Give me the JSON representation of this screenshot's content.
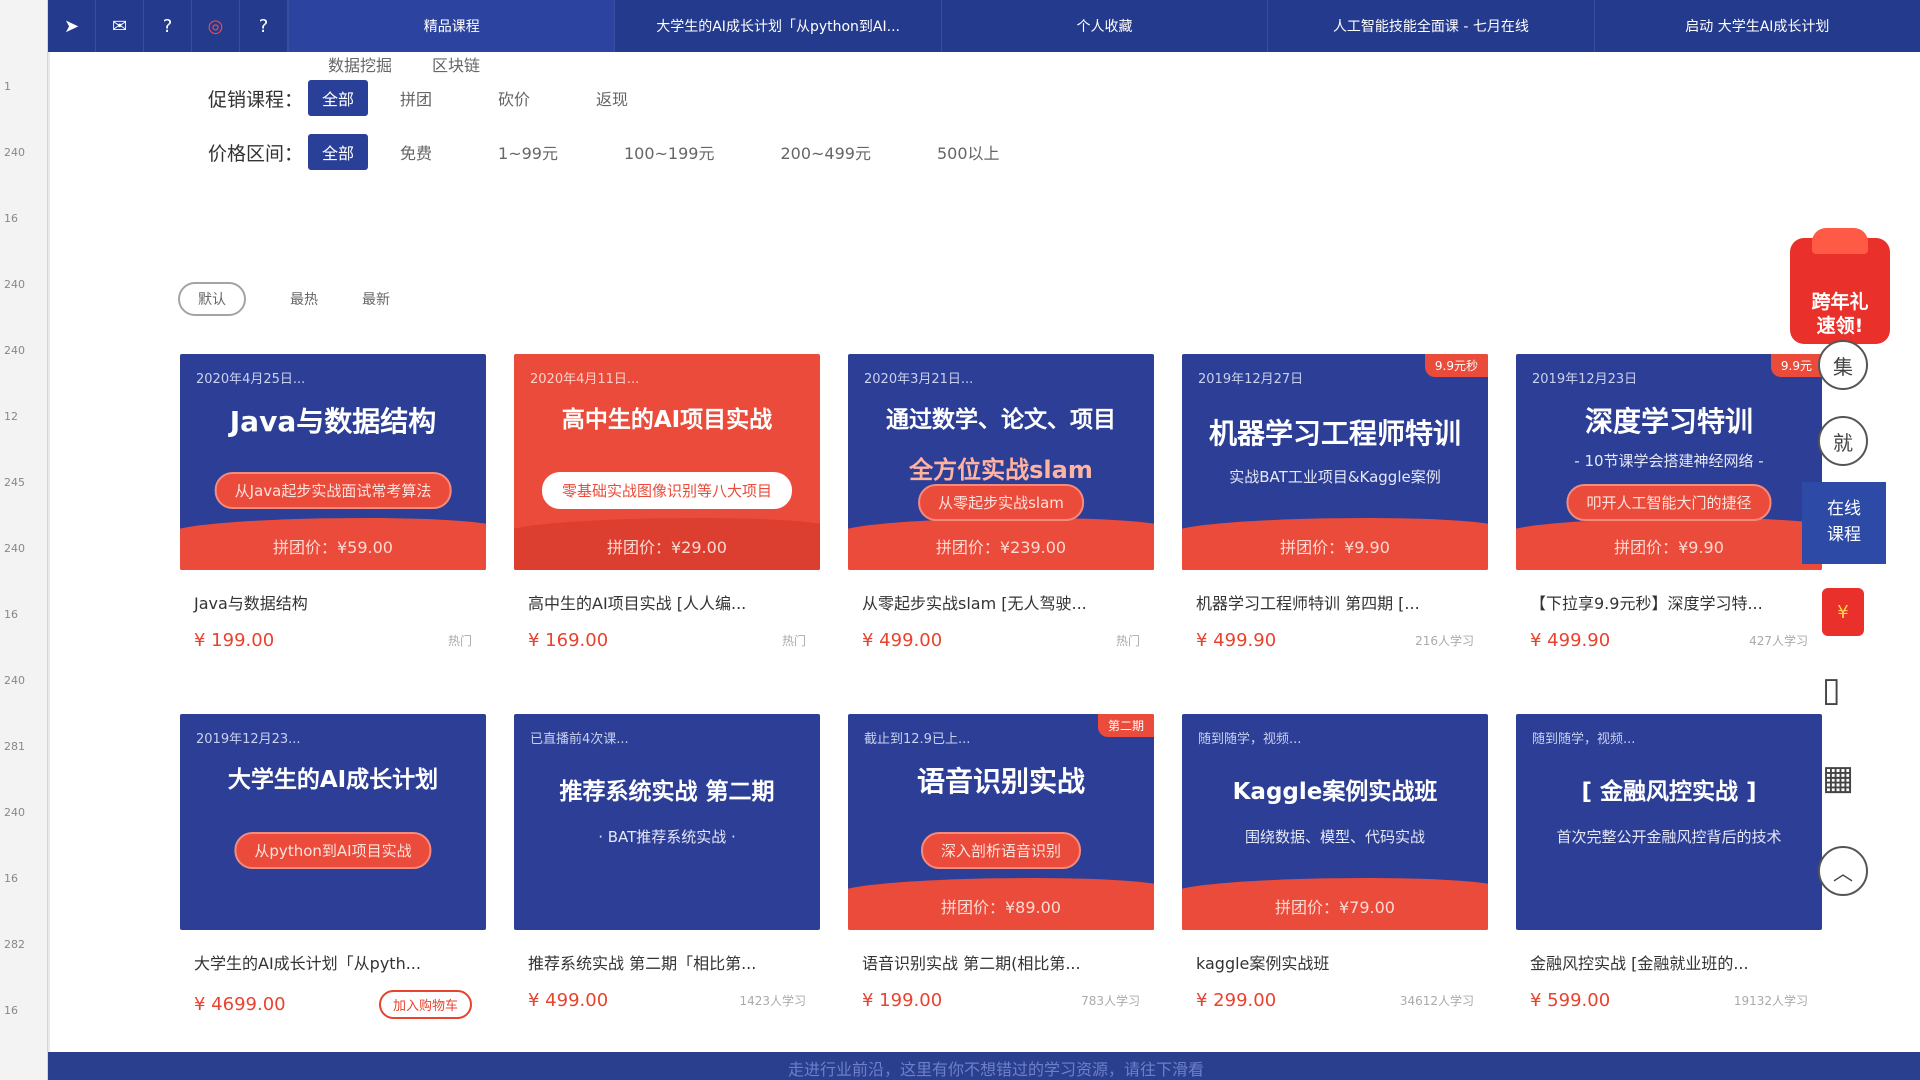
{
  "ruler": {
    "ticks": [
      "1",
      "240",
      "16",
      "240",
      "240",
      "12",
      "245",
      "240",
      "16",
      "240",
      "281",
      "240",
      "16",
      "282",
      "16"
    ]
  },
  "topbar": {
    "icons": [
      {
        "name": "cursor-icon",
        "glyph": "➤"
      },
      {
        "name": "mail-icon",
        "glyph": "✉"
      },
      {
        "name": "question-icon",
        "glyph": "?"
      },
      {
        "name": "record-icon",
        "glyph": "◎"
      },
      {
        "name": "help-icon",
        "glyph": "?"
      }
    ],
    "tabs": [
      "精品课程",
      "大学生的AI成长计划「从python到AI...",
      "个人收藏",
      "人工智能技能全面课 - 七月在线",
      "启动 大学生AI成长计划"
    ]
  },
  "subtags": [
    "数据挖掘",
    "区块链"
  ],
  "filters": {
    "promo": {
      "label": "促销课程：",
      "options": [
        "全部",
        "拼团",
        "砍价",
        "返现"
      ],
      "active": "全部"
    },
    "price": {
      "label": "价格区间：",
      "options": [
        "全部",
        "免费",
        "1~99元",
        "100~199元",
        "200~499元",
        "500以上"
      ],
      "active": "全部"
    }
  },
  "sort": [
    "默认",
    "最热",
    "最新"
  ],
  "courses": [
    {
      "date": "2020年4月25日...",
      "banner_title": "Java与数据结构",
      "banner_sub": "",
      "pill": "从Java起步实战面试常考算法",
      "group_price": "拼团价：¥59.00",
      "corner": "",
      "theme": "blue",
      "title": "Java与数据结构",
      "price": "¥ 199.00",
      "meta": "热门",
      "cart": ""
    },
    {
      "date": "2020年4月11日...",
      "banner_title": "高中生的AI项目实战",
      "banner_sub": "",
      "pill": "零基础实战图像识别等八大项目",
      "group_price": "拼团价：¥29.00",
      "corner": "",
      "theme": "red",
      "title": "高中生的AI项目实战 [人人编...",
      "price": "¥ 169.00",
      "meta": "热门",
      "cart": ""
    },
    {
      "date": "2020年3月21日...",
      "banner_title": "通过数学、论文、项目",
      "banner_sub": "全方位实战slam",
      "pill": "从零起步实战slam",
      "group_price": "拼团价：¥239.00",
      "corner": "",
      "theme": "blue",
      "title": "从零起步实战slam  [无人驾驶...",
      "price": "¥ 499.00",
      "meta": "热门",
      "cart": ""
    },
    {
      "date": "2019年12月27日",
      "banner_title": "机器学习工程师特训",
      "banner_sub": "实战BAT工业项目&Kaggle案例",
      "pill": "",
      "group_price": "拼团价：¥9.90",
      "corner": "9.9元秒",
      "theme": "blue",
      "title": "机器学习工程师特训 第四期 [...",
      "price": "¥ 499.90",
      "meta": "216人学习",
      "cart": ""
    },
    {
      "date": "2019年12月23日",
      "banner_title": "深度学习特训",
      "banner_sub": "- 10节课学会搭建神经网络 -",
      "pill": "叩开人工智能大门的捷径",
      "group_price": "拼团价：¥9.90",
      "corner": "9.9元",
      "theme": "blue",
      "title": "【下拉享9.9元秒】深度学习特...",
      "price": "¥ 499.90",
      "meta": "427人学习",
      "cart": ""
    },
    {
      "date": "2019年12月23...",
      "banner_title": "大学生的AI成长计划",
      "banner_sub": "",
      "pill": "从python到AI项目实战",
      "group_price": "",
      "corner": "",
      "theme": "blue",
      "title": "大学生的AI成长计划「从pyth...",
      "price": "¥ 4699.00",
      "meta": "",
      "cart": "加入购物车"
    },
    {
      "date": "已直播前4次课...",
      "banner_title": "推荐系统实战 第二期",
      "banner_sub": "· BAT推荐系统实战 ·",
      "pill": "",
      "group_price": "",
      "corner": "",
      "theme": "blue",
      "title": "推荐系统实战 第二期「相比第...",
      "price": "¥ 499.00",
      "meta": "1423人学习",
      "cart": ""
    },
    {
      "date": "截止到12.9已上...",
      "banner_title": "语音识别实战",
      "banner_sub": "",
      "pill": "深入剖析语音识别",
      "group_price": "拼团价：¥89.00",
      "corner": "第二期",
      "theme": "blue",
      "title": "语音识别实战 第二期(相比第...",
      "price": "¥ 199.00",
      "meta": "783人学习",
      "cart": ""
    },
    {
      "date": "随到随学，视频...",
      "banner_title": "Kaggle案例实战班",
      "banner_sub": "围绕数据、模型、代码实战",
      "pill": "",
      "group_price": "拼团价：¥79.00",
      "corner": "",
      "theme": "blue",
      "title": "kaggle案例实战班",
      "price": "¥ 299.00",
      "meta": "34612人学习",
      "cart": ""
    },
    {
      "date": "随到随学，视频...",
      "banner_title": "[ 金融风控实战 ]",
      "banner_sub": "首次完整公开金融风控背后的技术",
      "pill": "",
      "group_price": "",
      "corner": "",
      "theme": "blue",
      "title": "金融风控实战 [金融就业班的...",
      "price": "¥ 599.00",
      "meta": "19132人学习",
      "cart": ""
    }
  ],
  "sidebar": {
    "gift_line1": "跨年礼",
    "gift_line2": "速领!",
    "btn1": "集",
    "btn2": "就",
    "online_line1": "在线",
    "online_line2": "课程"
  },
  "bottom_text": "走进行业前沿，这里有你不想错过的学习资源，请往下滑看"
}
